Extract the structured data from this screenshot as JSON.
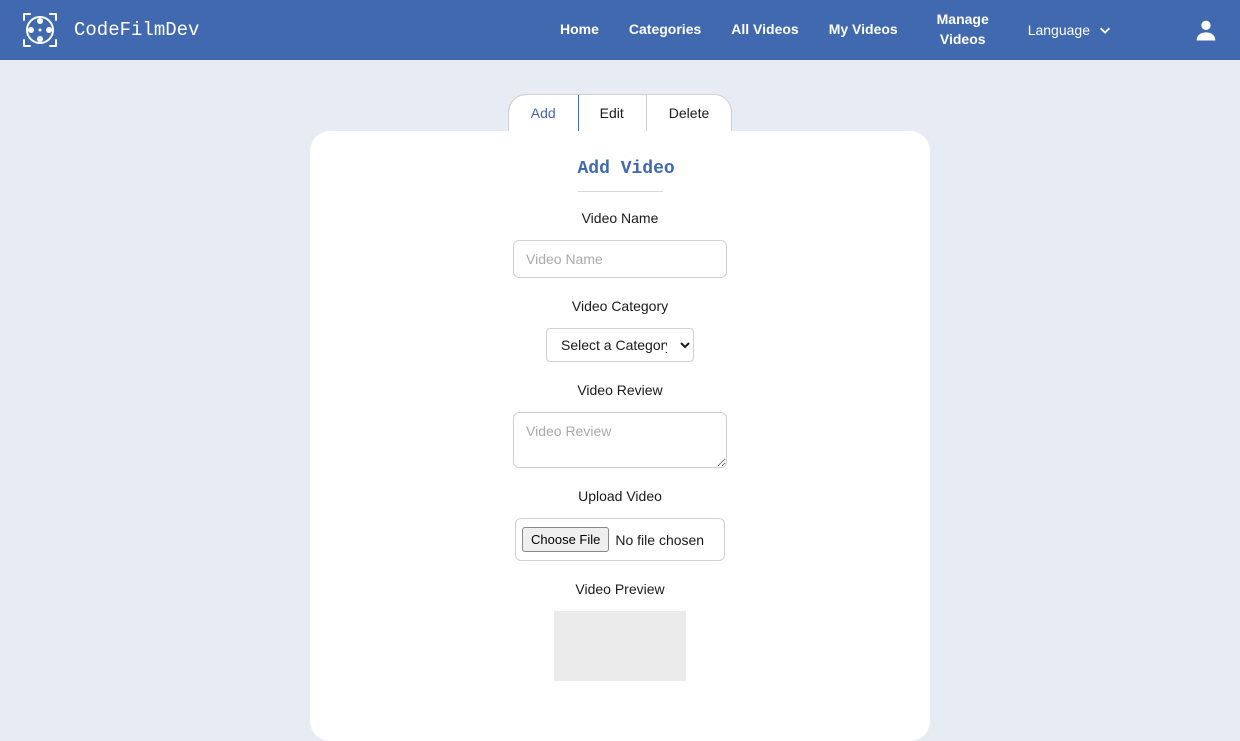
{
  "brand": {
    "name": "CodeFilmDev"
  },
  "nav": {
    "home": "Home",
    "categories": "Categories",
    "all_videos": "All Videos",
    "my_videos": "My Videos",
    "manage_videos": "Manage Videos",
    "language": "Language"
  },
  "tabs": {
    "add": "Add",
    "edit": "Edit",
    "delete": "Delete"
  },
  "form": {
    "title": "Add Video",
    "video_name": {
      "label": "Video Name",
      "placeholder": "Video Name"
    },
    "video_category": {
      "label": "Video Category",
      "selected": "Select a Category"
    },
    "video_review": {
      "label": "Video Review",
      "placeholder": "Video Review"
    },
    "upload_video": {
      "label": "Upload Video",
      "button": "Choose File",
      "status": "No file chosen"
    },
    "video_preview": {
      "label": "Video Preview"
    }
  }
}
